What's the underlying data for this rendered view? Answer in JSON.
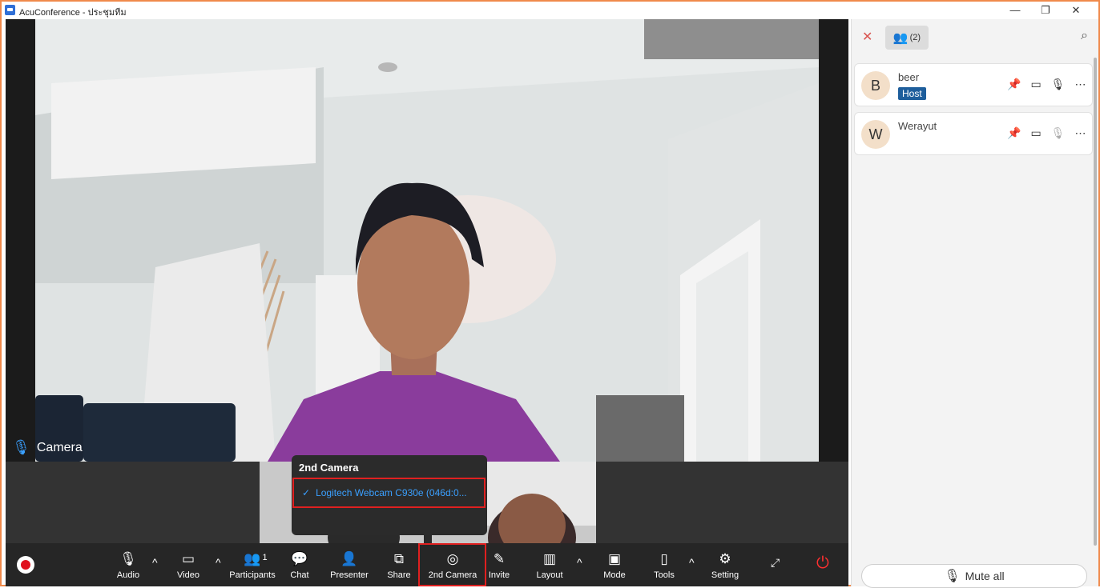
{
  "window": {
    "title": "AcuConference - ประชุมทีม",
    "minimize": "—",
    "restore": "❐",
    "close": "✕"
  },
  "video": {
    "label": "Camera",
    "mic_icon": "microphone-icon"
  },
  "second_camera_popup": {
    "title": "2nd Camera",
    "selected_device": "Logitech Webcam C930e (046d:0...",
    "check": "✓"
  },
  "toolbar": {
    "audio_label": "Audio",
    "video_label": "Video",
    "participants_label": "Participants",
    "participants_count": "1",
    "chat_label": "Chat",
    "presenter_label": "Presenter",
    "share_label": "Share",
    "second_camera_label": "2nd Camera",
    "invite_label": "Invite",
    "layout_label": "Layout",
    "mode_label": "Mode",
    "tools_label": "Tools",
    "setting_label": "Setting",
    "caret": "^"
  },
  "panel": {
    "participant_count": "(2)",
    "participants": [
      {
        "initial": "B",
        "name": "beer",
        "badge": "Host",
        "mic_muted": false
      },
      {
        "initial": "W",
        "name": "Werayut",
        "badge": "",
        "mic_muted": true
      }
    ],
    "mute_all_label": "Mute all"
  },
  "colors": {
    "accent_blue": "#3aa0ff",
    "host_badge": "#1e5e9c",
    "highlight_red": "#e02020",
    "window_border": "#f08a4b"
  }
}
